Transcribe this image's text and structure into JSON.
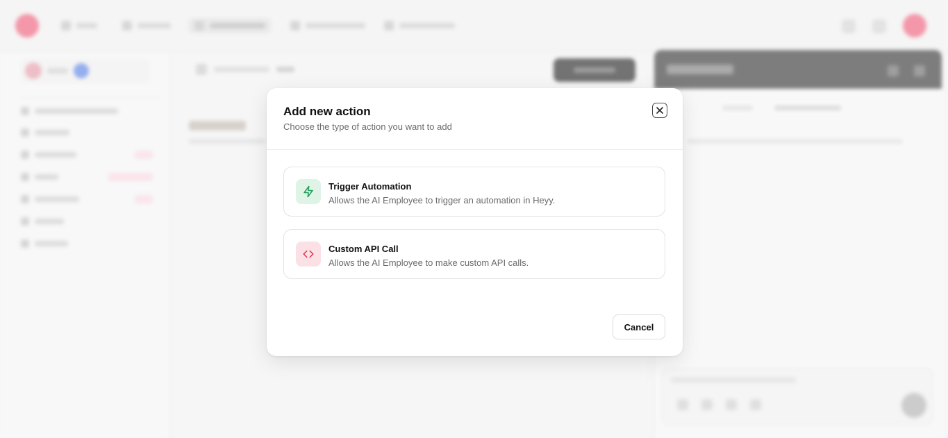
{
  "modal": {
    "title": "Add new action",
    "subtitle": "Choose the type of action you want to add",
    "options": [
      {
        "title": "Trigger Automation",
        "description": "Allows the AI Employee to trigger an automation in Heyy.",
        "icon": "lightning-icon",
        "icon_color": "#1f9d55",
        "icon_bg": "#dff3e6"
      },
      {
        "title": "Custom API Call",
        "description": "Allows the AI Employee to make custom API calls.",
        "icon": "code-brackets-icon",
        "icon_color": "#d6334f",
        "icon_bg": "#fbe1e5"
      }
    ],
    "cancel_label": "Cancel"
  },
  "colors": {
    "brand": "#f07089",
    "overlay_dark_header": "#4c4c4c"
  }
}
